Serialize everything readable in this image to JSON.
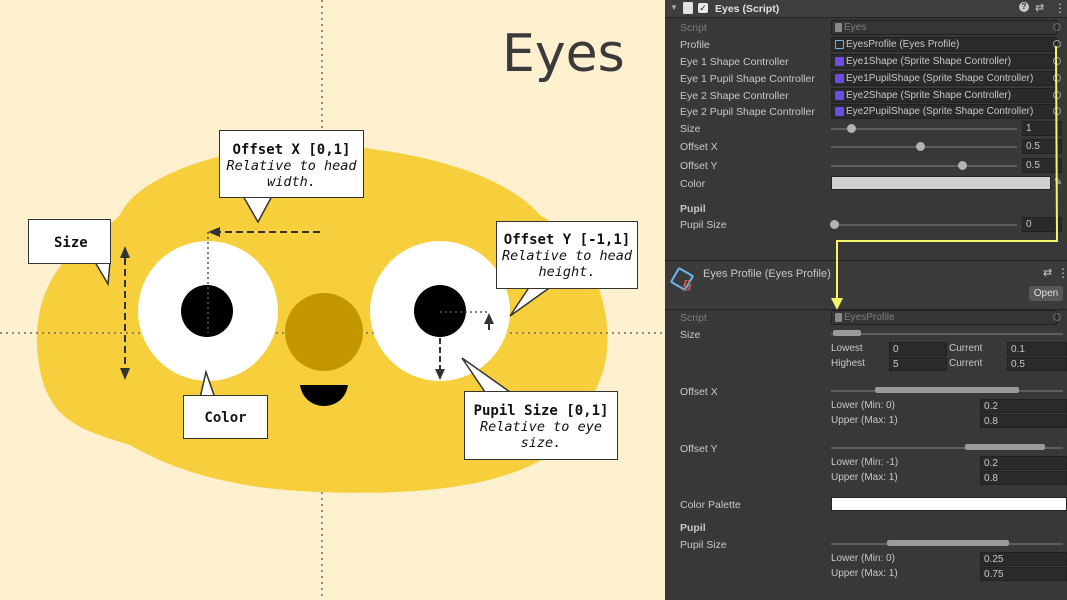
{
  "illustration": {
    "title": "Eyes",
    "callouts": {
      "offset_x": {
        "title": "Offset X [0,1]",
        "sub": "Relative to head width."
      },
      "offset_y": {
        "title": "Offset Y [-1,1]",
        "sub": "Relative to head height."
      },
      "size": {
        "title": "Size"
      },
      "color": {
        "title": "Color"
      },
      "pupil_size": {
        "title": "Pupil Size [0,1]",
        "sub": "Relative to eye size."
      }
    },
    "colors": {
      "background": "#fdf0cf",
      "head": "#f7cf3c",
      "nose": "#c49600",
      "eye": "#ffffff",
      "pupil": "#000000"
    }
  },
  "component": {
    "title": "Eyes (Script)",
    "enabled": true,
    "fields": [
      {
        "label": "Script",
        "value": "Eyes",
        "dim": true
      },
      {
        "label": "Profile",
        "value": "EyesProfile (Eyes Profile)"
      },
      {
        "label": "Eye 1 Shape Controller",
        "value": "Eye1Shape (Sprite Shape Controller)"
      },
      {
        "label": "Eye 1 Pupil Shape Controller",
        "value": "Eye1PupilShape (Sprite Shape Controller)"
      },
      {
        "label": "Eye 2 Shape Controller",
        "value": "Eye2Shape (Sprite Shape Controller)"
      },
      {
        "label": "Eye 2 Pupil Shape Controller",
        "value": "Eye2PupilShape (Sprite Shape Controller)"
      }
    ],
    "sliders": [
      {
        "label": "Size",
        "value": "1",
        "fraction": 0.1
      },
      {
        "label": "Offset X",
        "value": "0.5",
        "fraction": 0.5
      },
      {
        "label": "Offset Y",
        "value": "0.5",
        "fraction": 0.75
      }
    ],
    "color_label": "Color",
    "pupil_header": "Pupil",
    "pupil_size": {
      "label": "Pupil Size",
      "value": "0",
      "fraction": 0.0
    }
  },
  "profile": {
    "title": "Eyes Profile (Eyes Profile)",
    "open_button": "Open",
    "script": {
      "label": "Script",
      "value": "EyesProfile"
    },
    "size": {
      "label": "Size",
      "lowest_label": "Lowest",
      "lowest": "0",
      "highest_label": "Highest",
      "highest": "5",
      "current_label": "Current",
      "current_low": "0.1",
      "current_high": "0.5"
    },
    "offset_x": {
      "label": "Offset X",
      "lower_label": "Lower (Min: 0)",
      "lower": "0.2",
      "upper_label": "Upper (Max: 1)",
      "upper": "0.8"
    },
    "offset_y": {
      "label": "Offset Y",
      "lower_label": "Lower (Min: -1)",
      "lower": "0.2",
      "upper_label": "Upper (Max: 1)",
      "upper": "0.8"
    },
    "color_palette_label": "Color Palette",
    "pupil_header": "Pupil",
    "pupil_size": {
      "label": "Pupil Size",
      "lower_label": "Lower (Min: 0)",
      "lower": "0.25",
      "upper_label": "Upper (Max: 1)",
      "upper": "0.75"
    }
  },
  "colors": {
    "accent_arrow": "#f5f56a",
    "panel": "#383838",
    "field": "#2a2a2a",
    "controller_icon": "#6b4de6"
  }
}
